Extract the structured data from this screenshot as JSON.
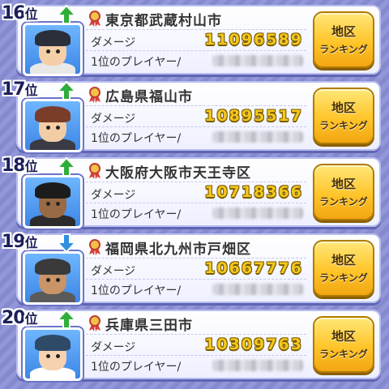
{
  "labels": {
    "rank_suffix": "位",
    "damage_label": "ダメージ",
    "top_player_label": "1位のプレイヤー/",
    "button_line1": "地区",
    "button_line2": "ランキング"
  },
  "rows": [
    {
      "rank": "16",
      "trend": "up",
      "region": "東京都武蔵村山市",
      "damage": "11096589"
    },
    {
      "rank": "17",
      "trend": "up",
      "region": "広島県福山市",
      "damage": "10895517"
    },
    {
      "rank": "18",
      "trend": "up",
      "region": "大阪府大阪市天王寺区",
      "damage": "10718366"
    },
    {
      "rank": "19",
      "trend": "down",
      "region": "福岡県北九州市戸畑区",
      "damage": "10667776"
    },
    {
      "rank": "20",
      "trend": "up",
      "region": "兵庫県三田市",
      "damage": "10309763"
    }
  ],
  "colors": {
    "background": "#8a8fd6",
    "up_arrow": "#2fae3a",
    "down_arrow": "#2f8fe0",
    "damage_value": "#f3c81d",
    "button": "#ffc52a"
  }
}
